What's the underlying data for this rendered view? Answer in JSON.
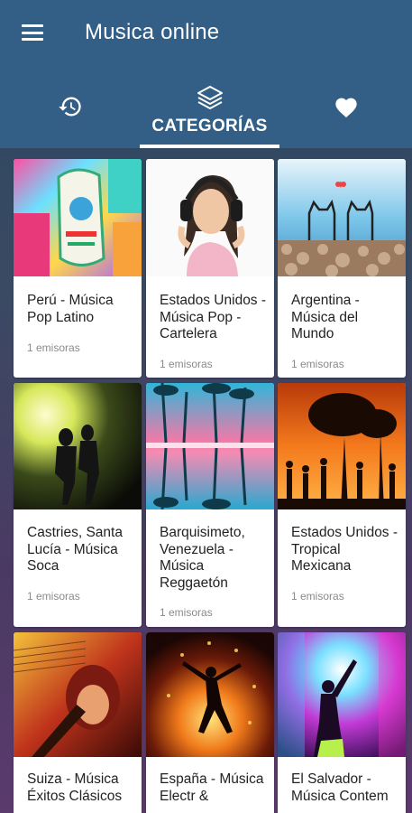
{
  "app": {
    "title": "Musica online"
  },
  "icons": {
    "menu": "menu-icon",
    "history": "history-icon",
    "categories": "layers-icon",
    "favorites": "heart-icon"
  },
  "tabs": {
    "categories_label": "CATEGORÍAS"
  },
  "colors": {
    "appbar": "#335f86",
    "card_text": "#222222",
    "count_text": "#8a8a8a"
  },
  "categories": [
    {
      "name": "Perú - Música Pop Latino",
      "count": "1 emisoras"
    },
    {
      "name": "Estados Unidos - Música Pop - Cartelera",
      "count": "1 emisoras"
    },
    {
      "name": "Argentina - Música del Mundo",
      "count": "1 emisoras"
    },
    {
      "name": "Castries, Santa Lucía - Música Soca",
      "count": "1 emisoras"
    },
    {
      "name": "Barquisimeto, Venezuela - Música Reggaetón",
      "count": "1 emisoras"
    },
    {
      "name": "Estados Unidos - Tropical Mexicana",
      "count": "1 emisoras"
    },
    {
      "name": "Suiza - Música Éxitos Clásicos",
      "count": ""
    },
    {
      "name": "España - Música Electr &",
      "count": ""
    },
    {
      "name": "El Salvador - Música Contem",
      "count": ""
    }
  ]
}
